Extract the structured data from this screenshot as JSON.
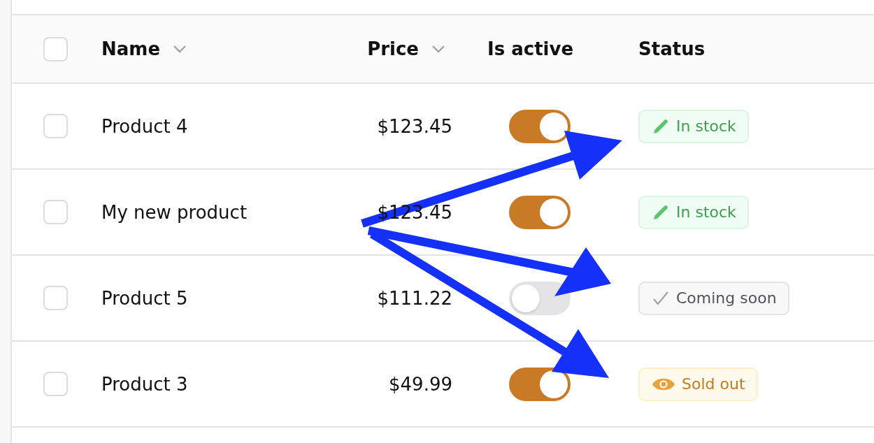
{
  "table": {
    "select_all": {
      "checked": false
    },
    "columns": [
      {
        "label": "Name",
        "sortable": true
      },
      {
        "label": "Price",
        "sortable": true
      },
      {
        "label": "Is active",
        "sortable": false
      },
      {
        "label": "Status",
        "sortable": false
      }
    ],
    "rows": [
      {
        "checked": false,
        "name": "Product 4",
        "price": "$123.45",
        "active": true,
        "status": {
          "kind": "success",
          "label": "In stock"
        }
      },
      {
        "checked": false,
        "name": "My new product",
        "price": "$123.45",
        "active": true,
        "status": {
          "kind": "success",
          "label": "In stock"
        }
      },
      {
        "checked": false,
        "name": "Product 5",
        "price": "$111.22",
        "active": false,
        "status": {
          "kind": "neutral",
          "label": "Coming soon"
        }
      },
      {
        "checked": false,
        "name": "Product 3",
        "price": "$49.99",
        "active": true,
        "status": {
          "kind": "warning",
          "label": "Sold out"
        }
      }
    ]
  }
}
